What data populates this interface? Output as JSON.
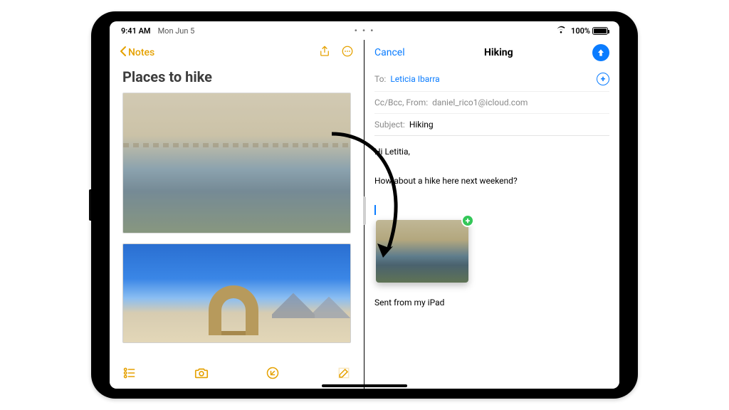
{
  "status": {
    "time": "9:41 AM",
    "date": "Mon Jun 5",
    "battery_pct": "100%"
  },
  "notes": {
    "back_label": "Notes",
    "title": "Places to hike"
  },
  "mail": {
    "cancel": "Cancel",
    "title": "Hiking",
    "labels": {
      "to": "To:",
      "ccbcc_from": "Cc/Bcc, From:",
      "subject": "Subject:"
    },
    "to_recipient": "Leticia Ibarra",
    "from_email": "daniel_rico1@icloud.com",
    "subject_value": "Hiking",
    "body": {
      "greeting": "Hi Letitia,",
      "line1": "How about a hike here next weekend?"
    },
    "signature": "Sent from my iPad"
  },
  "colors": {
    "notes_accent": "#e5a100",
    "mail_accent": "#0a7cff",
    "drop_badge": "#34c759"
  }
}
